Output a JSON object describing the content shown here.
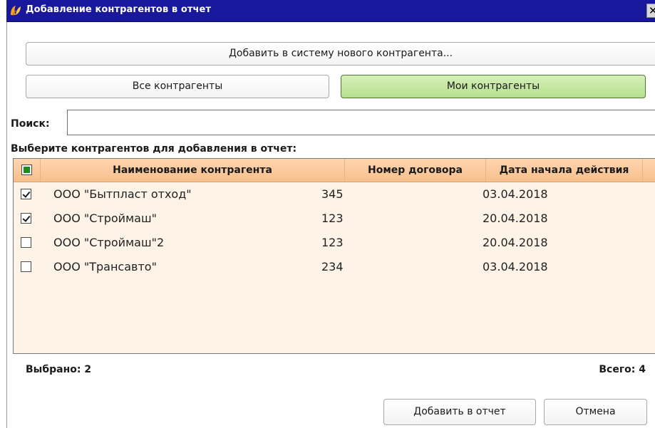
{
  "window": {
    "title": "Добавление контрагентов в отчет"
  },
  "actions": {
    "add_new_label": "Добавить в систему нового контрагента...",
    "all_label": "Все контрагенты",
    "mine_label": "Мои контрагенты"
  },
  "search": {
    "label": "Поиск:",
    "value": ""
  },
  "list": {
    "heading": "Выберите контрагентов для добавления в отчет:",
    "columns": [
      "Наименование контрагента",
      "Номер договора",
      "Дата начала действия"
    ],
    "rows": [
      {
        "checked": true,
        "name": "ООО \"Бытпласт отход\"",
        "contract": "345",
        "date": "03.04.2018"
      },
      {
        "checked": true,
        "name": "ООО \"Строймаш\"",
        "contract": "123",
        "date": "20.04.2018"
      },
      {
        "checked": false,
        "name": "ООО \"Строймаш\"2",
        "contract": "123",
        "date": "20.04.2018"
      },
      {
        "checked": false,
        "name": "ООО \"Трансавто\"",
        "contract": "234",
        "date": "03.04.2018"
      }
    ]
  },
  "footer": {
    "selected_label": "Выбрано: 2",
    "total_label": "Всего: 4",
    "add_to_report_label": "Добавить в отчет",
    "cancel_label": "Отмена"
  },
  "colors": {
    "titlebar": "#18189c",
    "header": "#f6bf8b",
    "grid_bg": "#fdf3e6",
    "active_tab": "#b7df8e"
  }
}
